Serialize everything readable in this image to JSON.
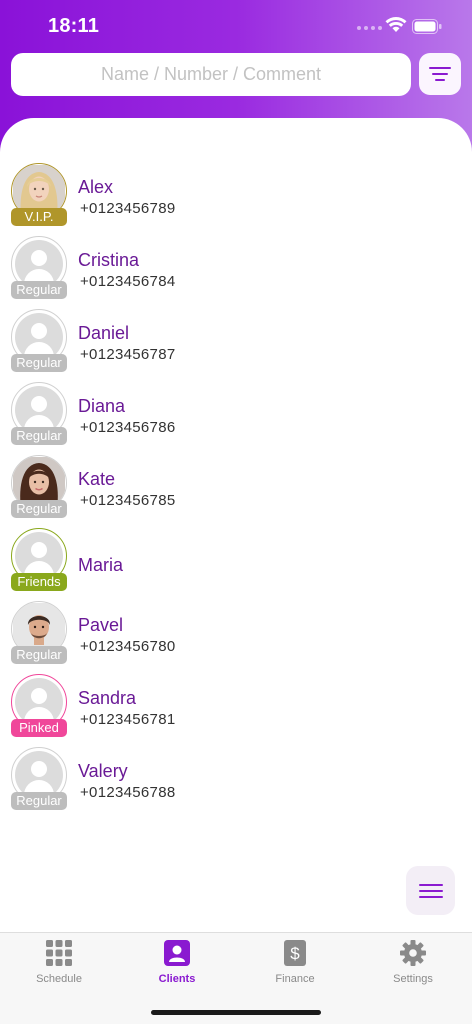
{
  "status_bar": {
    "time": "18:11"
  },
  "search": {
    "placeholder": "Name / Number / Comment",
    "value": ""
  },
  "clients": [
    {
      "name": "Alex",
      "phone": "+0123456789",
      "badge": "V.I.P.",
      "badge_color": "#b0962a",
      "ring_color": "#b0962a",
      "avatar": "photo-blonde-woman"
    },
    {
      "name": "Cristina",
      "phone": "+0123456784",
      "badge": "Regular",
      "badge_color": "#bdbdbd",
      "ring_color": "#d0d0d0",
      "avatar": "placeholder"
    },
    {
      "name": "Daniel",
      "phone": "+0123456787",
      "badge": "Regular",
      "badge_color": "#bdbdbd",
      "ring_color": "#d0d0d0",
      "avatar": "placeholder"
    },
    {
      "name": "Diana",
      "phone": "+0123456786",
      "badge": "Regular",
      "badge_color": "#bdbdbd",
      "ring_color": "#d0d0d0",
      "avatar": "placeholder"
    },
    {
      "name": "Kate",
      "phone": "+0123456785",
      "badge": "Regular",
      "badge_color": "#bdbdbd",
      "ring_color": "#d0d0d0",
      "avatar": "photo-brunette-woman"
    },
    {
      "name": "Maria",
      "phone": "",
      "badge": "Friends",
      "badge_color": "#8aa81c",
      "ring_color": "#8aa81c",
      "avatar": "placeholder"
    },
    {
      "name": "Pavel",
      "phone": "+0123456780",
      "badge": "Regular",
      "badge_color": "#bdbdbd",
      "ring_color": "#d0d0d0",
      "avatar": "photo-man"
    },
    {
      "name": "Sandra",
      "phone": "+0123456781",
      "badge": "Pinked",
      "badge_color": "#f0479a",
      "ring_color": "#f0479a",
      "avatar": "placeholder"
    },
    {
      "name": "Valery",
      "phone": "+0123456788",
      "badge": "Regular",
      "badge_color": "#bdbdbd",
      "ring_color": "#d0d0d0",
      "avatar": "placeholder"
    }
  ],
  "tabs": [
    {
      "label": "Schedule",
      "icon": "grid-icon",
      "active": false
    },
    {
      "label": "Clients",
      "icon": "person-icon",
      "active": true
    },
    {
      "label": "Finance",
      "icon": "dollar-icon",
      "active": false
    },
    {
      "label": "Settings",
      "icon": "gear-icon",
      "active": false
    }
  ],
  "colors": {
    "accent": "#8a1ad0",
    "name_text": "#6a1a96",
    "header_start": "#8a12d8",
    "header_end": "#b978ea"
  }
}
